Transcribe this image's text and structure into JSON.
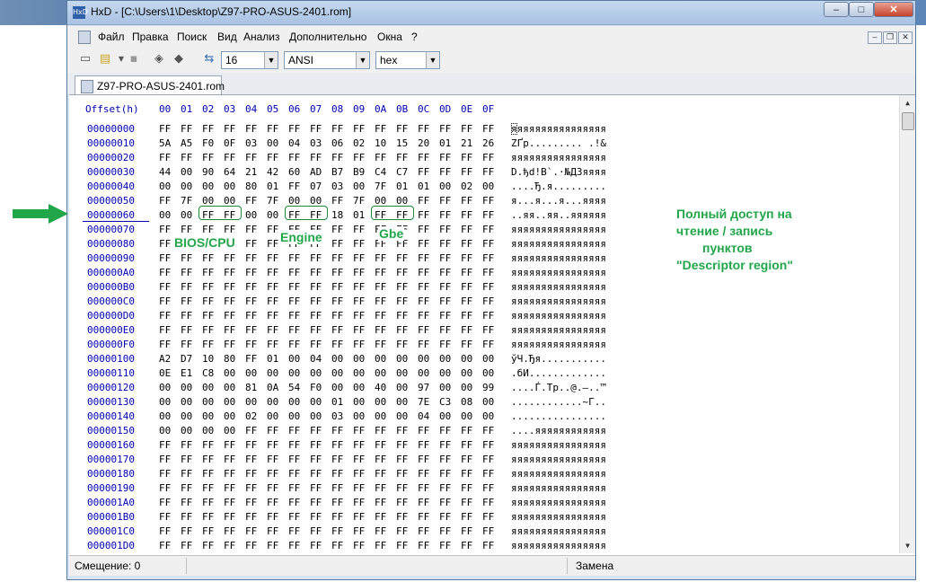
{
  "window": {
    "title": "HxD - [C:\\Users\\1\\Desktop\\Z97-PRO-ASUS-2401.rom]",
    "buttons": {
      "minimize": "‒",
      "maximize": "□",
      "close": "✕"
    }
  },
  "menu": {
    "items": [
      "Файл",
      "Правка",
      "Поиск",
      "Вид",
      "Анализ",
      "Дополнительно",
      "Окна",
      "?"
    ],
    "mdi": {
      "minimize": "–",
      "restore": "❐",
      "close": "✕"
    }
  },
  "toolbar": {
    "bytes_per_row": "16",
    "charset": "ANSI",
    "offset_base": "hex",
    "dropdown_arrow": "▼",
    "icons": {
      "new": "▭",
      "open": "▤",
      "save": "▪",
      "tool1": "◈",
      "tool2": "◆",
      "columns": "⇆"
    }
  },
  "tab": {
    "label": "Z97-PRO-ASUS-2401.rom"
  },
  "hex": {
    "offset_header": "Offset(h)",
    "columns": [
      "00",
      "01",
      "02",
      "03",
      "04",
      "05",
      "06",
      "07",
      "08",
      "09",
      "0A",
      "0B",
      "0C",
      "0D",
      "0E",
      "0F"
    ],
    "rows": [
      {
        "offset": "00000000",
        "bytes": [
          "FF",
          "FF",
          "FF",
          "FF",
          "FF",
          "FF",
          "FF",
          "FF",
          "FF",
          "FF",
          "FF",
          "FF",
          "FF",
          "FF",
          "FF",
          "FF"
        ],
        "ascii": "яяяяяяяяяяяяяяяя"
      },
      {
        "offset": "00000010",
        "bytes": [
          "5A",
          "A5",
          "F0",
          "0F",
          "03",
          "00",
          "04",
          "03",
          "06",
          "02",
          "10",
          "15",
          "20",
          "01",
          "21",
          "26"
        ],
        "ascii": "ZҐр......... .!&"
      },
      {
        "offset": "00000020",
        "bytes": [
          "FF",
          "FF",
          "FF",
          "FF",
          "FF",
          "FF",
          "FF",
          "FF",
          "FF",
          "FF",
          "FF",
          "FF",
          "FF",
          "FF",
          "FF",
          "FF"
        ],
        "ascii": "яяяяяяяяяяяяяяяя"
      },
      {
        "offset": "00000030",
        "bytes": [
          "44",
          "00",
          "90",
          "64",
          "21",
          "42",
          "60",
          "AD",
          "B7",
          "B9",
          "C4",
          "C7",
          "FF",
          "FF",
          "FF",
          "FF"
        ],
        "ascii": "D.ђd!B`.·№ДЗяяяя"
      },
      {
        "offset": "00000040",
        "bytes": [
          "00",
          "00",
          "00",
          "00",
          "80",
          "01",
          "FF",
          "07",
          "03",
          "00",
          "7F",
          "01",
          "01",
          "00",
          "02",
          "00"
        ],
        "ascii": "....Ђ.я........."
      },
      {
        "offset": "00000050",
        "bytes": [
          "FF",
          "7F",
          "00",
          "00",
          "FF",
          "7F",
          "00",
          "00",
          "FF",
          "7F",
          "00",
          "00",
          "FF",
          "FF",
          "FF",
          "FF"
        ],
        "ascii": "я...я...я...яяяя"
      },
      {
        "offset": "00000060",
        "bytes": [
          "00",
          "00",
          "FF",
          "FF",
          "00",
          "00",
          "FF",
          "FF",
          "18",
          "01",
          "FF",
          "FF",
          "FF",
          "FF",
          "FF",
          "FF"
        ],
        "ascii": "..яя..яя..яяяяяя"
      },
      {
        "offset": "00000070",
        "bytes": [
          "FF",
          "FF",
          "FF",
          "FF",
          "FF",
          "FF",
          "FF",
          "FF",
          "FF",
          "FF",
          "FF",
          "FF",
          "FF",
          "FF",
          "FF",
          "FF"
        ],
        "ascii": "яяяяяяяяяяяяяяяя"
      },
      {
        "offset": "00000080",
        "bytes": [
          "FF",
          "FF",
          "FF",
          "FF",
          "FF",
          "FF",
          "FF",
          "FF",
          "FF",
          "FF",
          "FF",
          "FF",
          "FF",
          "FF",
          "FF",
          "FF"
        ],
        "ascii": "яяяяяяяяяяяяяяяя"
      },
      {
        "offset": "00000090",
        "bytes": [
          "FF",
          "FF",
          "FF",
          "FF",
          "FF",
          "FF",
          "FF",
          "FF",
          "FF",
          "FF",
          "FF",
          "FF",
          "FF",
          "FF",
          "FF",
          "FF"
        ],
        "ascii": "яяяяяяяяяяяяяяяя"
      },
      {
        "offset": "000000A0",
        "bytes": [
          "FF",
          "FF",
          "FF",
          "FF",
          "FF",
          "FF",
          "FF",
          "FF",
          "FF",
          "FF",
          "FF",
          "FF",
          "FF",
          "FF",
          "FF",
          "FF"
        ],
        "ascii": "яяяяяяяяяяяяяяяя"
      },
      {
        "offset": "000000B0",
        "bytes": [
          "FF",
          "FF",
          "FF",
          "FF",
          "FF",
          "FF",
          "FF",
          "FF",
          "FF",
          "FF",
          "FF",
          "FF",
          "FF",
          "FF",
          "FF",
          "FF"
        ],
        "ascii": "яяяяяяяяяяяяяяяя"
      },
      {
        "offset": "000000C0",
        "bytes": [
          "FF",
          "FF",
          "FF",
          "FF",
          "FF",
          "FF",
          "FF",
          "FF",
          "FF",
          "FF",
          "FF",
          "FF",
          "FF",
          "FF",
          "FF",
          "FF"
        ],
        "ascii": "яяяяяяяяяяяяяяяя"
      },
      {
        "offset": "000000D0",
        "bytes": [
          "FF",
          "FF",
          "FF",
          "FF",
          "FF",
          "FF",
          "FF",
          "FF",
          "FF",
          "FF",
          "FF",
          "FF",
          "FF",
          "FF",
          "FF",
          "FF"
        ],
        "ascii": "яяяяяяяяяяяяяяяя"
      },
      {
        "offset": "000000E0",
        "bytes": [
          "FF",
          "FF",
          "FF",
          "FF",
          "FF",
          "FF",
          "FF",
          "FF",
          "FF",
          "FF",
          "FF",
          "FF",
          "FF",
          "FF",
          "FF",
          "FF"
        ],
        "ascii": "яяяяяяяяяяяяяяяя"
      },
      {
        "offset": "000000F0",
        "bytes": [
          "FF",
          "FF",
          "FF",
          "FF",
          "FF",
          "FF",
          "FF",
          "FF",
          "FF",
          "FF",
          "FF",
          "FF",
          "FF",
          "FF",
          "FF",
          "FF"
        ],
        "ascii": "яяяяяяяяяяяяяяяя"
      },
      {
        "offset": "00000100",
        "bytes": [
          "A2",
          "D7",
          "10",
          "80",
          "FF",
          "01",
          "00",
          "04",
          "00",
          "00",
          "00",
          "00",
          "00",
          "00",
          "00",
          "00"
        ],
        "ascii": "ўЧ.Ђя..........."
      },
      {
        "offset": "00000110",
        "bytes": [
          "0E",
          "E1",
          "C8",
          "00",
          "00",
          "00",
          "00",
          "00",
          "00",
          "00",
          "00",
          "00",
          "00",
          "00",
          "00",
          "00"
        ],
        "ascii": ".бИ............."
      },
      {
        "offset": "00000120",
        "bytes": [
          "00",
          "00",
          "00",
          "00",
          "81",
          "0A",
          "54",
          "F0",
          "00",
          "00",
          "40",
          "00",
          "97",
          "00",
          "00",
          "99"
        ],
        "ascii": "....Ѓ.Tр..@.—..™"
      },
      {
        "offset": "00000130",
        "bytes": [
          "00",
          "00",
          "00",
          "00",
          "00",
          "00",
          "00",
          "00",
          "01",
          "00",
          "00",
          "00",
          "7E",
          "C3",
          "08",
          "00"
        ],
        "ascii": "............~Г.."
      },
      {
        "offset": "00000140",
        "bytes": [
          "00",
          "00",
          "00",
          "00",
          "02",
          "00",
          "00",
          "00",
          "03",
          "00",
          "00",
          "00",
          "04",
          "00",
          "00",
          "00"
        ],
        "ascii": "................"
      },
      {
        "offset": "00000150",
        "bytes": [
          "00",
          "00",
          "00",
          "00",
          "FF",
          "FF",
          "FF",
          "FF",
          "FF",
          "FF",
          "FF",
          "FF",
          "FF",
          "FF",
          "FF",
          "FF"
        ],
        "ascii": "....яяяяяяяяяяяя"
      },
      {
        "offset": "00000160",
        "bytes": [
          "FF",
          "FF",
          "FF",
          "FF",
          "FF",
          "FF",
          "FF",
          "FF",
          "FF",
          "FF",
          "FF",
          "FF",
          "FF",
          "FF",
          "FF",
          "FF"
        ],
        "ascii": "яяяяяяяяяяяяяяяя"
      },
      {
        "offset": "00000170",
        "bytes": [
          "FF",
          "FF",
          "FF",
          "FF",
          "FF",
          "FF",
          "FF",
          "FF",
          "FF",
          "FF",
          "FF",
          "FF",
          "FF",
          "FF",
          "FF",
          "FF"
        ],
        "ascii": "яяяяяяяяяяяяяяяя"
      },
      {
        "offset": "00000180",
        "bytes": [
          "FF",
          "FF",
          "FF",
          "FF",
          "FF",
          "FF",
          "FF",
          "FF",
          "FF",
          "FF",
          "FF",
          "FF",
          "FF",
          "FF",
          "FF",
          "FF"
        ],
        "ascii": "яяяяяяяяяяяяяяяя"
      },
      {
        "offset": "00000190",
        "bytes": [
          "FF",
          "FF",
          "FF",
          "FF",
          "FF",
          "FF",
          "FF",
          "FF",
          "FF",
          "FF",
          "FF",
          "FF",
          "FF",
          "FF",
          "FF",
          "FF"
        ],
        "ascii": "яяяяяяяяяяяяяяяя"
      },
      {
        "offset": "000001A0",
        "bytes": [
          "FF",
          "FF",
          "FF",
          "FF",
          "FF",
          "FF",
          "FF",
          "FF",
          "FF",
          "FF",
          "FF",
          "FF",
          "FF",
          "FF",
          "FF",
          "FF"
        ],
        "ascii": "яяяяяяяяяяяяяяяя"
      },
      {
        "offset": "000001B0",
        "bytes": [
          "FF",
          "FF",
          "FF",
          "FF",
          "FF",
          "FF",
          "FF",
          "FF",
          "FF",
          "FF",
          "FF",
          "FF",
          "FF",
          "FF",
          "FF",
          "FF"
        ],
        "ascii": "яяяяяяяяяяяяяяяя"
      },
      {
        "offset": "000001C0",
        "bytes": [
          "FF",
          "FF",
          "FF",
          "FF",
          "FF",
          "FF",
          "FF",
          "FF",
          "FF",
          "FF",
          "FF",
          "FF",
          "FF",
          "FF",
          "FF",
          "FF"
        ],
        "ascii": "яяяяяяяяяяяяяяяя"
      },
      {
        "offset": "000001D0",
        "bytes": [
          "FF",
          "FF",
          "FF",
          "FF",
          "FF",
          "FF",
          "FF",
          "FF",
          "FF",
          "FF",
          "FF",
          "FF",
          "FF",
          "FF",
          "FF",
          "FF"
        ],
        "ascii": "яяяяяяяяяяяяяяяя"
      }
    ]
  },
  "annotations": {
    "bios_cpu": "BIOS/CPU",
    "engine": "Engine",
    "gbe": "Gbe",
    "note_lines": [
      "Полный доступ на",
      "чтение / запись",
      "пунктов",
      "\"Descriptor region\""
    ]
  },
  "scrollbar": {
    "up": "▲",
    "down": "▼"
  },
  "status": {
    "offset": "Смещение: 0",
    "mode": "Замена"
  },
  "colors": {
    "annotation": "#22a64a",
    "offset": "#0000b0"
  }
}
